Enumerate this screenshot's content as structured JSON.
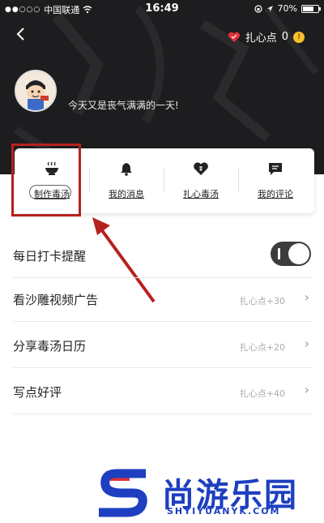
{
  "statusbar": {
    "carrier": "中国联通",
    "time": "16:49",
    "battery": "70%"
  },
  "header": {
    "points_label": "扎心点",
    "points_value": "0",
    "coin_glyph": "!",
    "tagline": "今天又是丧气满满的一天!"
  },
  "actions": [
    {
      "label": "制作毒汤",
      "icon": "bowl-icon"
    },
    {
      "label": "我的消息",
      "icon": "bell-icon"
    },
    {
      "label": "扎心毒汤",
      "icon": "heart-icon"
    },
    {
      "label": "我的评论",
      "icon": "comment-icon"
    }
  ],
  "list": [
    {
      "title": "每日打卡提醒",
      "toggle_on": true
    },
    {
      "title": "看沙雕视频广告",
      "reward": "扎心点+30"
    },
    {
      "title": "分享毒汤日历",
      "reward": "扎心点+20"
    },
    {
      "title": "写点好评",
      "reward": "扎心点+40"
    }
  ],
  "watermark": {
    "brand_cn": "尚游乐园",
    "brand_en": "SHYIYUANYK.COM"
  },
  "colors": {
    "header_bg": "#1d1d1f",
    "highlight": "#b7211d",
    "heart": "#e0323a",
    "coin": "#f5c02a",
    "watermark": "#1d3fc0"
  }
}
